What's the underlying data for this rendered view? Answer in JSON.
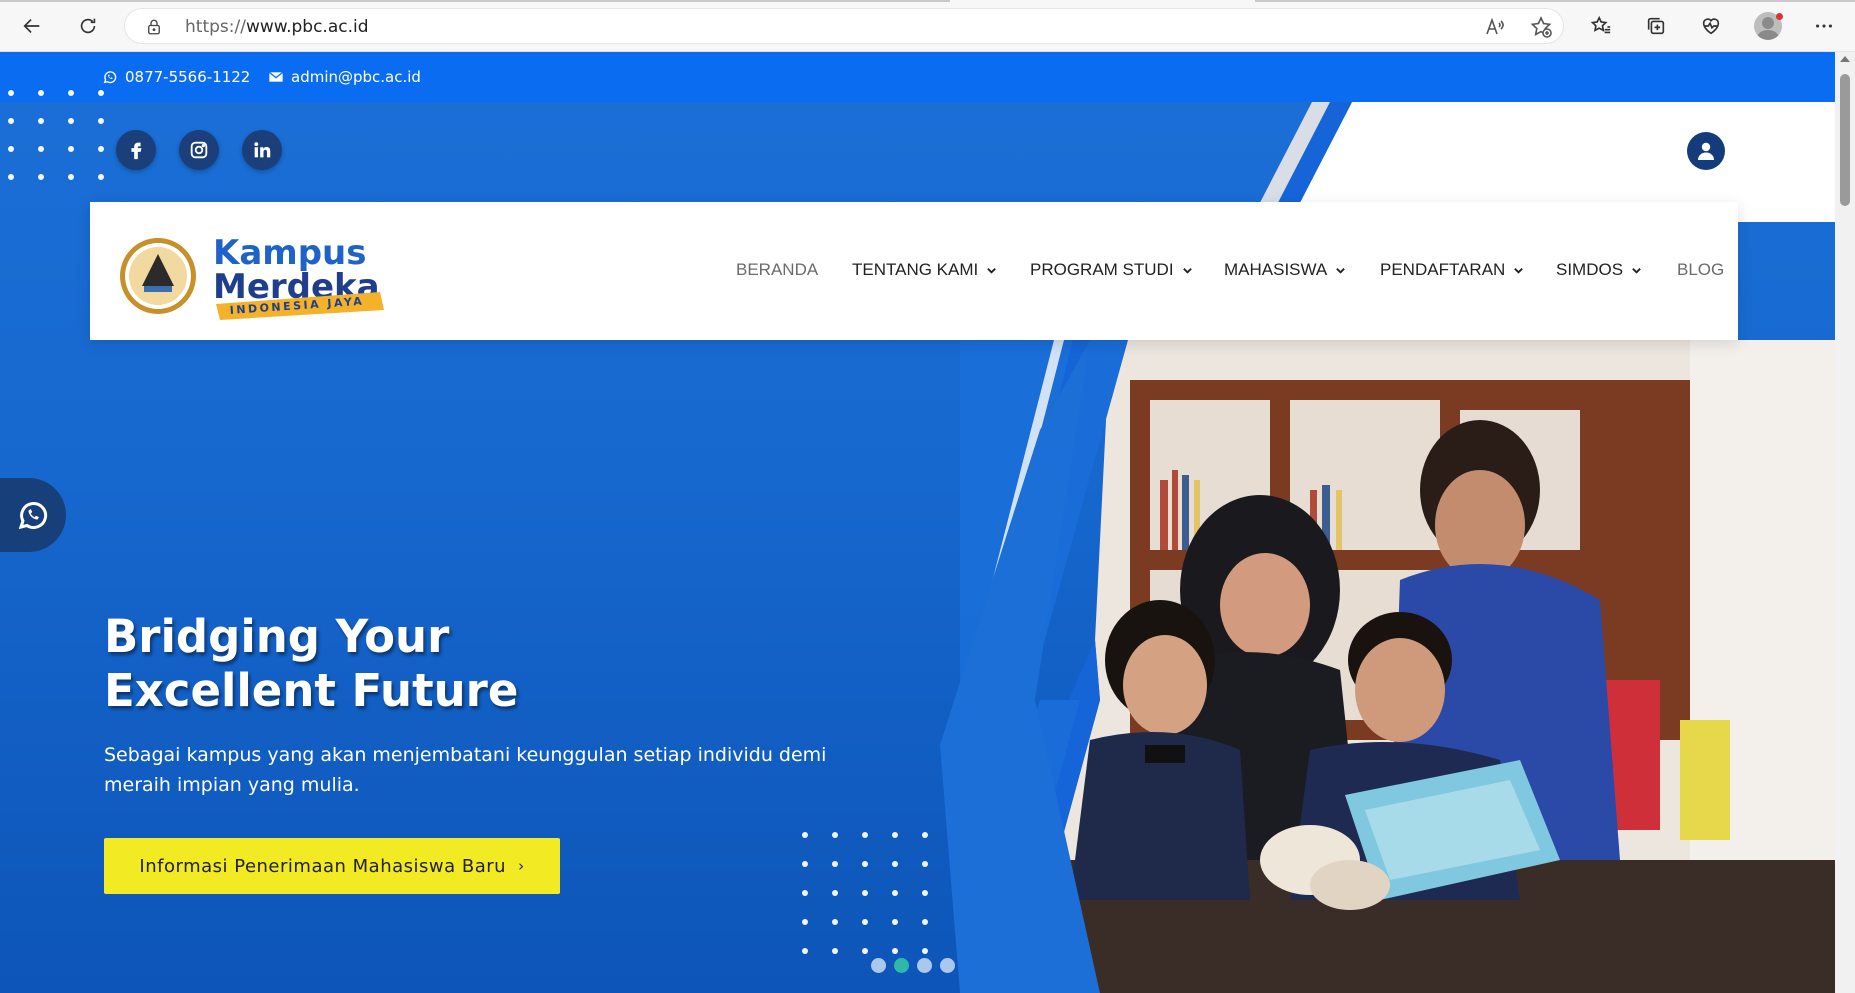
{
  "browser": {
    "url_protocol": "https://",
    "url_host": "www.pbc.ac.id"
  },
  "topbar": {
    "phone": "0877-5566-1122",
    "email": "admin@pbc.ac.id"
  },
  "social": [
    "facebook-icon",
    "instagram-icon",
    "linkedin-icon"
  ],
  "logo": {
    "line1": "Kampus",
    "line2": "Merdeka",
    "ribbon": "INDONESIA JAYA"
  },
  "nav": {
    "items": [
      {
        "label": "BERANDA",
        "dropdown": false
      },
      {
        "label": "TENTANG KAMI",
        "dropdown": true
      },
      {
        "label": "PROGRAM STUDI",
        "dropdown": true
      },
      {
        "label": "MAHASISWA",
        "dropdown": true
      },
      {
        "label": "PENDAFTARAN",
        "dropdown": true
      },
      {
        "label": "SIMDOS",
        "dropdown": true
      },
      {
        "label": "BLOG",
        "dropdown": false
      }
    ]
  },
  "hero": {
    "title_line1": "Bridging Your",
    "title_line2": "Excellent Future",
    "subtitle": "Sebagai kampus yang akan menjembatani keunggulan setiap individu demi meraih impian yang mulia.",
    "cta_label": "Informasi Penerimaan Mahasiswa Baru",
    "cta_arrow": "›"
  },
  "slider": {
    "count": 4,
    "active_index": 1
  },
  "colors": {
    "topbar": "#0a6cf0",
    "hero_blue": "#1769d0",
    "cta_yellow": "#f2ea22",
    "social_bg": "#1a3f7a"
  }
}
